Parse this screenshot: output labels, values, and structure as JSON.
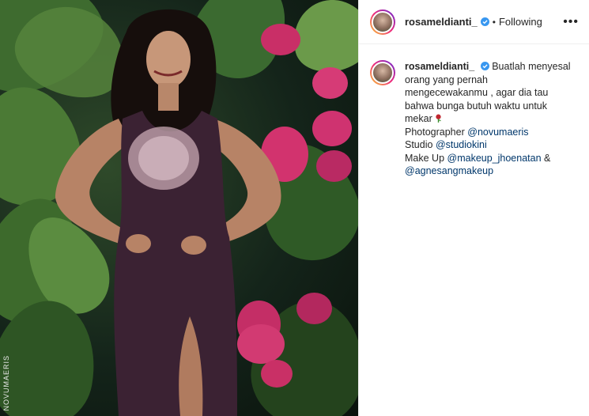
{
  "header": {
    "username": "rosameldianti_",
    "separator": "•",
    "follow_status": "Following",
    "more_label": "•••"
  },
  "photo": {
    "watermark": "NOVUMAERIS"
  },
  "caption": {
    "username": "rosameldianti_",
    "text": "Buatlah menyesal orang yang pernah mengecewakanmu , agar dia tau bahwa bunga butuh waktu untuk mekar",
    "photographer_label": "Photographer",
    "photographer_mention": "@novumaeris",
    "studio_label": "Studio",
    "studio_mention": "@studiokini",
    "makeup_label": "Make Up",
    "makeup_mention_1": "@makeup_jhoenatan",
    "makeup_joiner": "&",
    "makeup_mention_2": "@agnesangmakeup"
  },
  "colors": {
    "verified_blue": "#3897f0",
    "mention_blue": "#00376b",
    "dress_purple": "#3b2233",
    "bougainvillea_pink": "#d2336e"
  }
}
